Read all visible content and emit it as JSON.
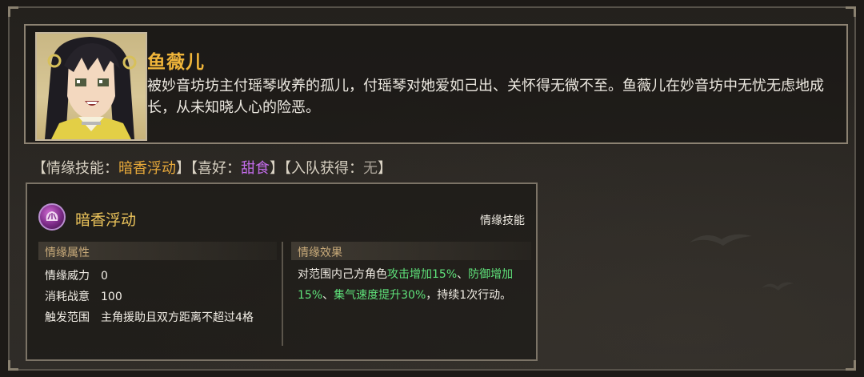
{
  "character": {
    "name": "鱼薇儿",
    "description": "被妙音坊坊主付瑶琴收养的孤儿，付瑶琴对她爱如己出、关怀得无微不至。鱼薇儿在妙音坊中无忧无虑地成长，从未知晓人心的险恶。"
  },
  "tags": {
    "skill_label": "【情缘技能：",
    "skill_value": "暗香浮动",
    "skill_close": "】",
    "hobby_label": "【喜好：",
    "hobby_value": "甜食",
    "hobby_close": "】",
    "join_label": "【入队获得：",
    "join_value": "无",
    "join_close": "】"
  },
  "skill": {
    "icon": "fan-hand-icon",
    "name": "暗香浮动",
    "type": "情缘技能",
    "attributes_title": "情缘属性",
    "attributes": [
      {
        "label": "情缘威力",
        "value": "0"
      },
      {
        "label": "消耗战意",
        "value": "100"
      },
      {
        "label": "触发范围",
        "value": "主角援助且双方距离不超过4格"
      }
    ],
    "effect_title": "情缘效果",
    "effect_parts": {
      "p1": "对范围内己方角色",
      "g1": "攻击增加15%",
      "p2": "、",
      "g2": "防御增加15%",
      "p3": "、",
      "g3": "集气速度提升30%",
      "p4": "，持续1次行动。"
    }
  },
  "colors": {
    "name": "#f0b53a",
    "skill_value": "#e7a93a",
    "hobby_value": "#c16be8",
    "effect_highlight": "#5fe27a"
  }
}
